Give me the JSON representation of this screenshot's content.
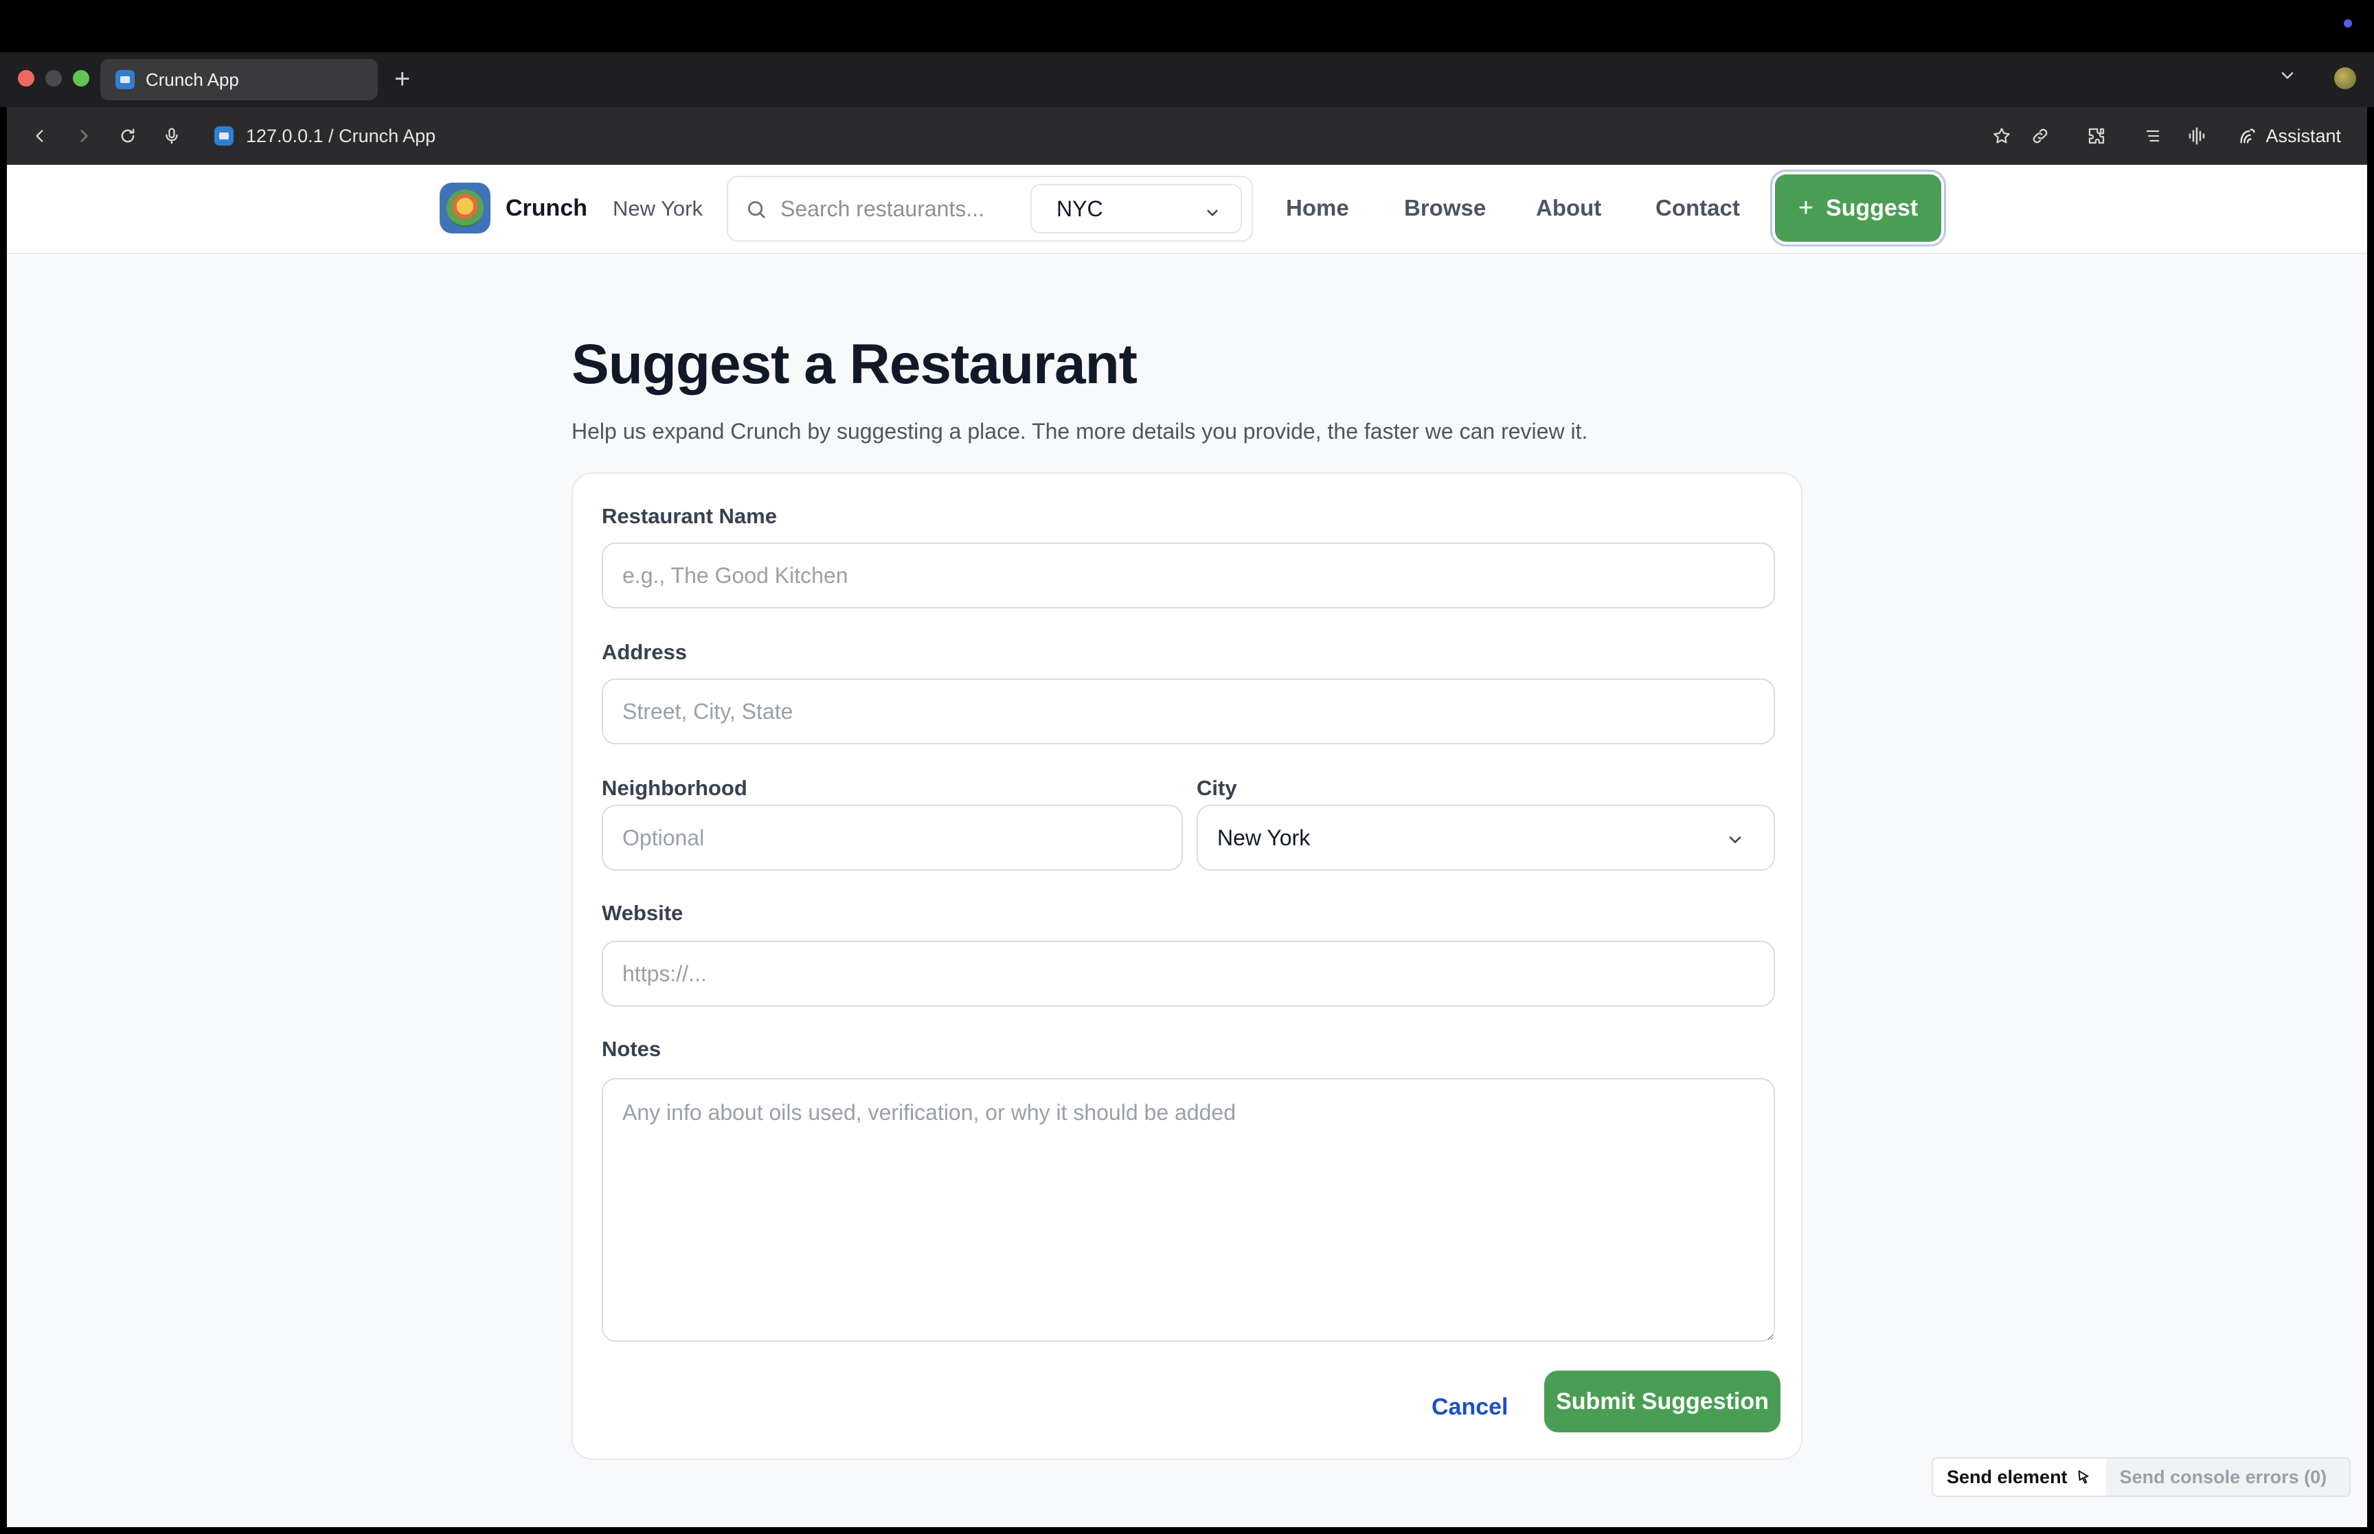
{
  "browser": {
    "tab_title": "Crunch App",
    "url": "127.0.0.1 / Crunch App",
    "assistant_label": "Assistant"
  },
  "header": {
    "brand": "Crunch",
    "city": "New York",
    "search_placeholder": "Search restaurants...",
    "metro_selected": "NYC",
    "nav": {
      "home": "Home",
      "browse": "Browse",
      "about": "About",
      "contact": "Contact"
    },
    "suggest_label": "Suggest"
  },
  "page": {
    "title": "Suggest a Restaurant",
    "subtitle": "Help us expand Crunch by suggesting a place. The more details you provide, the faster we can review it."
  },
  "form": {
    "name_label": "Restaurant Name",
    "name_placeholder": "e.g., The Good Kitchen",
    "address_label": "Address",
    "address_placeholder": "Street, City, State",
    "neighborhood_label": "Neighborhood",
    "neighborhood_placeholder": "Optional",
    "city_label": "City",
    "city_selected": "New York",
    "website_label": "Website",
    "website_placeholder": "https://...",
    "notes_label": "Notes",
    "notes_placeholder": "Any info about oils used, verification, or why it should be added",
    "cancel_label": "Cancel",
    "submit_label": "Submit Suggestion"
  },
  "devtools": {
    "send_element": "Send element",
    "send_errors": "Send console errors (0)"
  },
  "colors": {
    "accent_green": "#4a9e54",
    "link_blue": "#1d4fc4",
    "page_bg": "#f8f9fa"
  }
}
